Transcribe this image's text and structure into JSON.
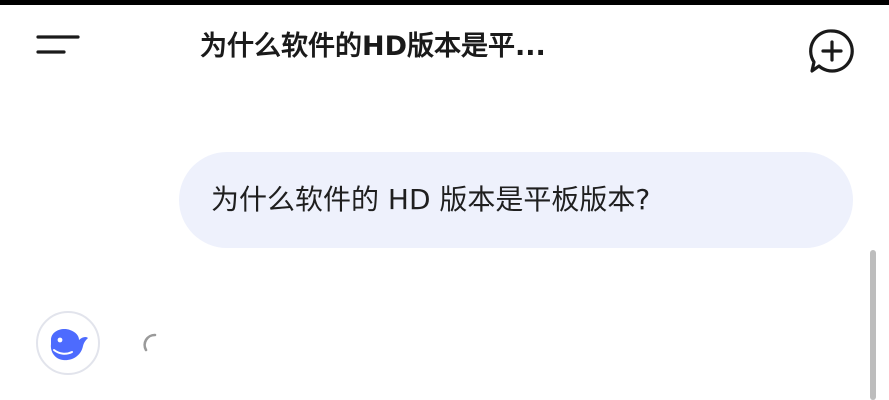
{
  "header": {
    "title": "为什么软件的HD版本是平...",
    "menu_icon": "menu-icon",
    "new_chat_icon": "new-chat-plus-icon"
  },
  "messages": [
    {
      "role": "user",
      "text": "为什么软件的 HD 版本是平板版本?"
    }
  ],
  "assistant": {
    "avatar_icon": "whale-logo-icon",
    "status_icon": "loading-spinner-icon"
  },
  "colors": {
    "bubble_background": "#eef1fc",
    "brand_blue": "#4d6bfe",
    "text_primary": "#1a1a1a"
  }
}
